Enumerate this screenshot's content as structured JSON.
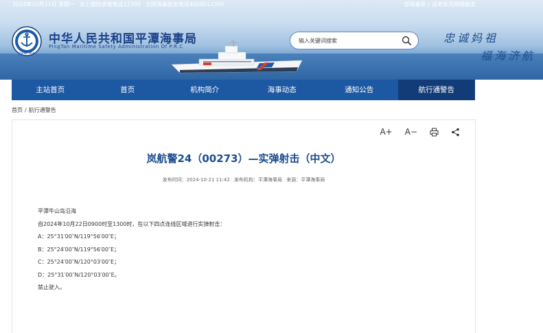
{
  "topbar": {
    "date_text": "2024年10月21日 星期一",
    "hotline_rescue": "水上遇险求救电话12395",
    "hotline_service": "全国海事服务电话4008012395",
    "link_ministry": "部海事局",
    "link_elderly": "适老化无障碍服务",
    "separator": "|"
  },
  "header": {
    "logo_text": "CHINA MSA",
    "site_title": "中华人民共和国平潭海事局",
    "site_subtitle": "PingTan  Maritime  Safety  Administration  Of  P.R.C",
    "slogan_line1": "忠诚妈祖",
    "slogan_line2": "福海济航"
  },
  "search": {
    "placeholder": "输入关键词搜索"
  },
  "nav": {
    "items": [
      {
        "label": "主站首页"
      },
      {
        "label": "首页"
      },
      {
        "label": "机构简介"
      },
      {
        "label": "海事动态"
      },
      {
        "label": "通知公告"
      },
      {
        "label": "航行通警告",
        "active": true
      }
    ]
  },
  "breadcrumb": {
    "home": "首页",
    "separator": "/",
    "current": "航行通警告"
  },
  "toolbar": {
    "font_increase": "A+",
    "font_decrease": "A−",
    "print_icon": "printer-icon",
    "share_icon": "share-icon"
  },
  "article": {
    "title": "岚航警24（00273）—实弹射击（中文）",
    "publish_time": "发布时间：2024-10-21 11:42",
    "publisher": "发布机构：平潭海事局",
    "source": "来源：平潭海事局",
    "paragraphs": [
      "平潭牛山岛沿海",
      "自2024年10月22日0900时至1300时，在以下四点连线区域进行实弹射击：",
      "A：25°31′00″N/119°56′00″E；",
      "B：25°24′00″N/119°56′00″E；",
      "C：25°24′00″N/120°03′00″E；",
      "D：25°31′00″N/120°03′00″E。",
      "禁止驶入。"
    ]
  },
  "colors": {
    "nav_bg": "#1d58a3",
    "nav_active": "#123c78",
    "title_blue": "#1a4c8f"
  }
}
